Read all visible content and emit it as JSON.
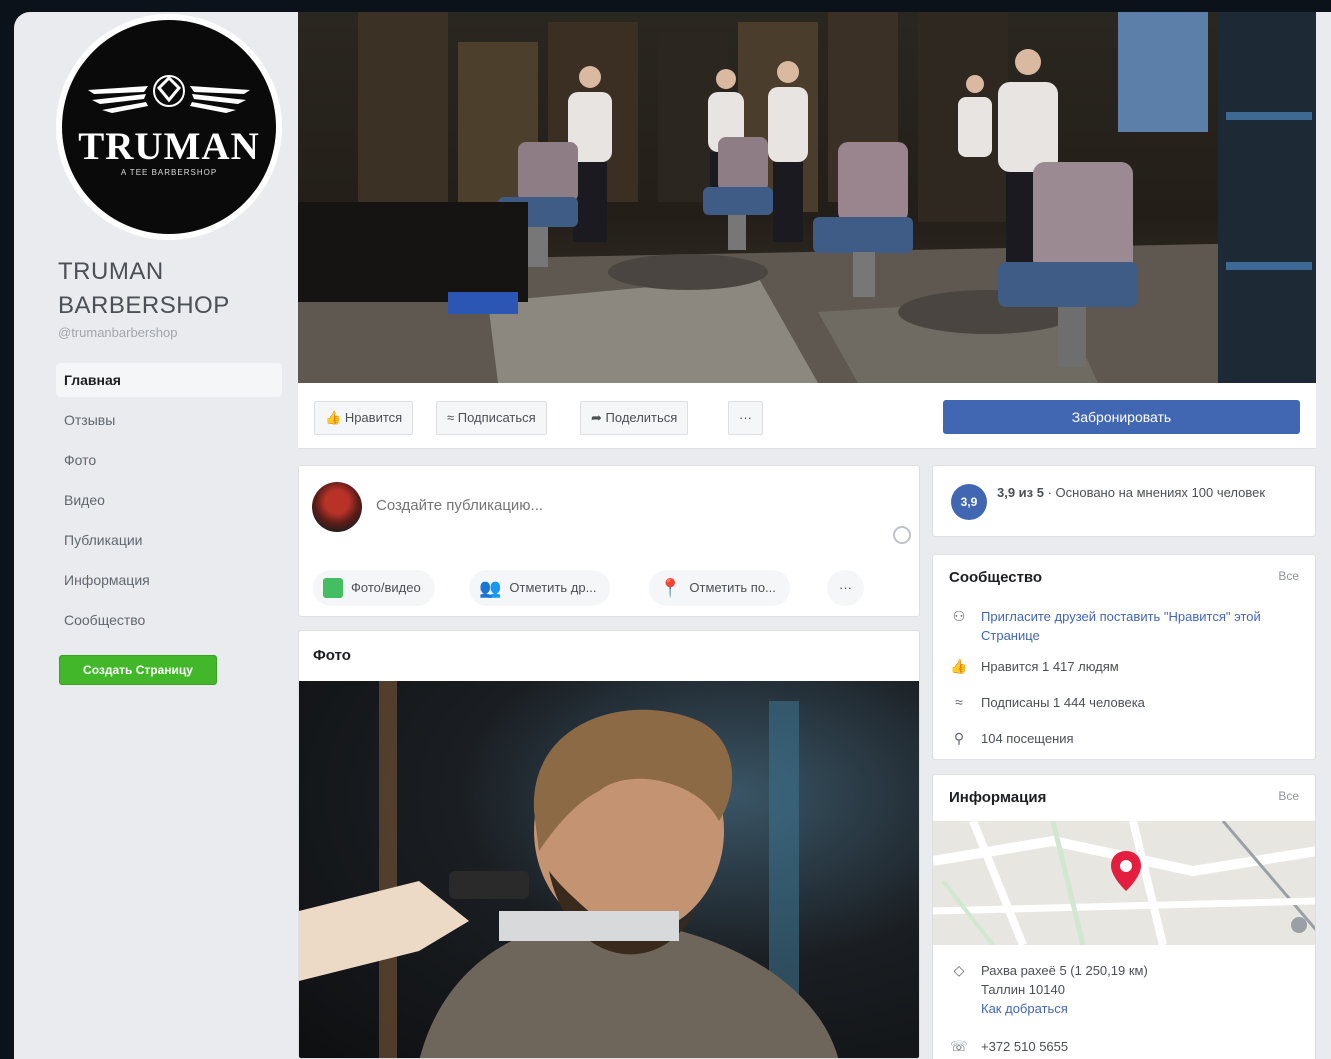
{
  "colors": {
    "accent": "#4267b2",
    "create_button": "#42b72a",
    "page_bg": "#e9ebee",
    "pin": "#e41e3f"
  },
  "profile": {
    "logo_text": "TRUMAN",
    "logo_sub": "A TEE BARBERSHOP",
    "name": "TRUMAN BARBERSHOP",
    "handle": "@trumanbarbershop"
  },
  "nav": {
    "items": [
      "Главная",
      "Отзывы",
      "Фото",
      "Видео",
      "Публикации",
      "Информация",
      "Сообщество"
    ],
    "active_index": 0,
    "create_page": "Создать Страницу"
  },
  "actions": {
    "like": "Нравится",
    "follow": "Подписаться",
    "share": "Поделиться",
    "more": "···",
    "book": "Забронировать"
  },
  "composer": {
    "placeholder": "Создайте публикацию...",
    "photo_video": "Фото/видео",
    "tag_friends": "Отметить др...",
    "check_in": "Отметить по...",
    "more": "···"
  },
  "photos": {
    "title": "Фото"
  },
  "rating": {
    "badge": "3,9",
    "score": "3,9 из 5",
    "text": "· Основано на мнениях 100 человек"
  },
  "community": {
    "title": "Сообщество",
    "see_all": "Все",
    "invite": "Пригласите друзей поставить \"Нравится\" этой Странице",
    "likes": "Нравится 1 417 людям",
    "followers": "Подписаны 1 444 человека",
    "checkins": "104 посещения",
    "icons": [
      "invite-icon",
      "like-icon",
      "follow-icon",
      "checkin-icon"
    ]
  },
  "info": {
    "title": "Информация",
    "see_all": "Все",
    "address": "Рахва рахеё 5 (1 250,19 км)",
    "city": "Таллин 10140",
    "directions": "Как добраться",
    "phone": "+372 510 5655",
    "icons": [
      "address-pin-icon",
      "phone-icon"
    ]
  }
}
